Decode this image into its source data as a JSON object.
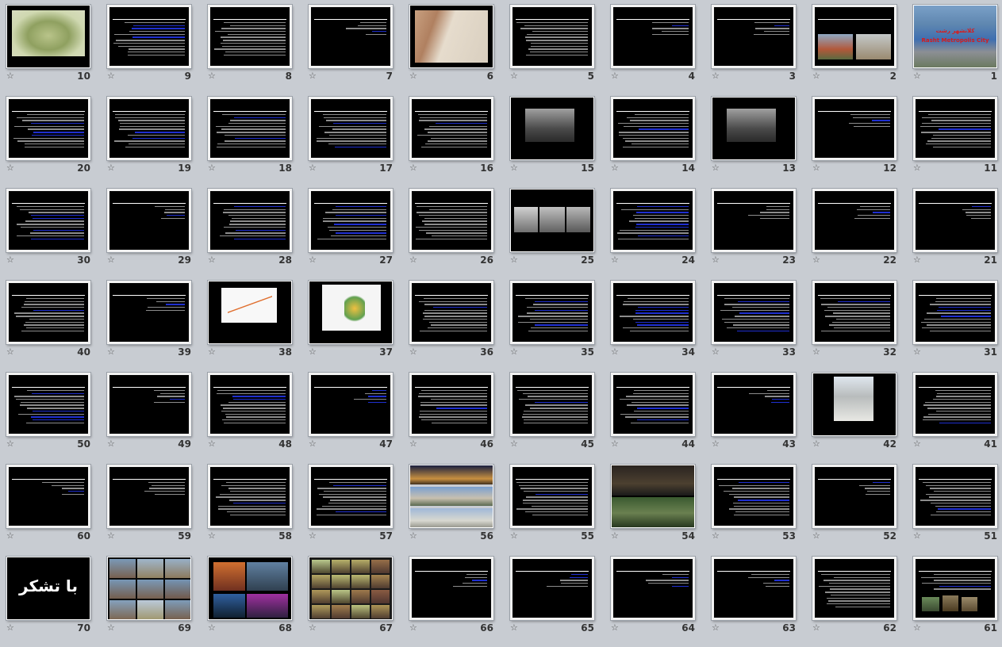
{
  "view": "slide-sorter",
  "star_glyph": "☆",
  "thanks_text": "با تشکر",
  "cover": {
    "title_fa": "کلانشهر رشت",
    "title_en": "Rasht Metropolis City"
  },
  "slides": [
    {
      "n": "1",
      "kind": "cover"
    },
    {
      "n": "2",
      "kind": "photo-pair"
    },
    {
      "n": "3",
      "kind": "text-sparse"
    },
    {
      "n": "4",
      "kind": "text-sparse"
    },
    {
      "n": "5",
      "kind": "text"
    },
    {
      "n": "6",
      "kind": "map"
    },
    {
      "n": "7",
      "kind": "text-sparse"
    },
    {
      "n": "8",
      "kind": "text"
    },
    {
      "n": "9",
      "kind": "text"
    },
    {
      "n": "10",
      "kind": "map-green"
    },
    {
      "n": "11",
      "kind": "text"
    },
    {
      "n": "12",
      "kind": "text-sparse"
    },
    {
      "n": "13",
      "kind": "photo"
    },
    {
      "n": "14",
      "kind": "text"
    },
    {
      "n": "15",
      "kind": "photo"
    },
    {
      "n": "16",
      "kind": "text"
    },
    {
      "n": "17",
      "kind": "text"
    },
    {
      "n": "18",
      "kind": "text"
    },
    {
      "n": "19",
      "kind": "text"
    },
    {
      "n": "20",
      "kind": "text"
    },
    {
      "n": "21",
      "kind": "text-sparse"
    },
    {
      "n": "22",
      "kind": "text-sparse"
    },
    {
      "n": "23",
      "kind": "text-sparse"
    },
    {
      "n": "24",
      "kind": "text"
    },
    {
      "n": "25",
      "kind": "photo-triple"
    },
    {
      "n": "26",
      "kind": "text"
    },
    {
      "n": "27",
      "kind": "text"
    },
    {
      "n": "28",
      "kind": "text"
    },
    {
      "n": "29",
      "kind": "text-sparse"
    },
    {
      "n": "30",
      "kind": "text"
    },
    {
      "n": "31",
      "kind": "text"
    },
    {
      "n": "32",
      "kind": "text"
    },
    {
      "n": "33",
      "kind": "text"
    },
    {
      "n": "34",
      "kind": "text"
    },
    {
      "n": "35",
      "kind": "text"
    },
    {
      "n": "36",
      "kind": "text"
    },
    {
      "n": "37",
      "kind": "chart-map"
    },
    {
      "n": "38",
      "kind": "chart"
    },
    {
      "n": "39",
      "kind": "text-sparse"
    },
    {
      "n": "40",
      "kind": "text"
    },
    {
      "n": "41",
      "kind": "text"
    },
    {
      "n": "42",
      "kind": "photo-monument"
    },
    {
      "n": "43",
      "kind": "text-sparse"
    },
    {
      "n": "44",
      "kind": "text"
    },
    {
      "n": "45",
      "kind": "text"
    },
    {
      "n": "46",
      "kind": "text"
    },
    {
      "n": "47",
      "kind": "text-sparse"
    },
    {
      "n": "48",
      "kind": "text"
    },
    {
      "n": "49",
      "kind": "text-sparse"
    },
    {
      "n": "50",
      "kind": "text"
    },
    {
      "n": "51",
      "kind": "text"
    },
    {
      "n": "52",
      "kind": "text-sparse"
    },
    {
      "n": "53",
      "kind": "text"
    },
    {
      "n": "54",
      "kind": "photo-stadium"
    },
    {
      "n": "55",
      "kind": "text"
    },
    {
      "n": "56",
      "kind": "photo-stack"
    },
    {
      "n": "57",
      "kind": "text"
    },
    {
      "n": "58",
      "kind": "text"
    },
    {
      "n": "59",
      "kind": "text-sparse"
    },
    {
      "n": "60",
      "kind": "text-sparse"
    },
    {
      "n": "61",
      "kind": "text-photos"
    },
    {
      "n": "62",
      "kind": "text"
    },
    {
      "n": "63",
      "kind": "text-sparse"
    },
    {
      "n": "64",
      "kind": "text-sparse"
    },
    {
      "n": "65",
      "kind": "text-sparse"
    },
    {
      "n": "66",
      "kind": "text-sparse"
    },
    {
      "n": "67",
      "kind": "collage"
    },
    {
      "n": "68",
      "kind": "collage-dark"
    },
    {
      "n": "69",
      "kind": "collage-buildings"
    },
    {
      "n": "70",
      "kind": "thanks"
    }
  ]
}
